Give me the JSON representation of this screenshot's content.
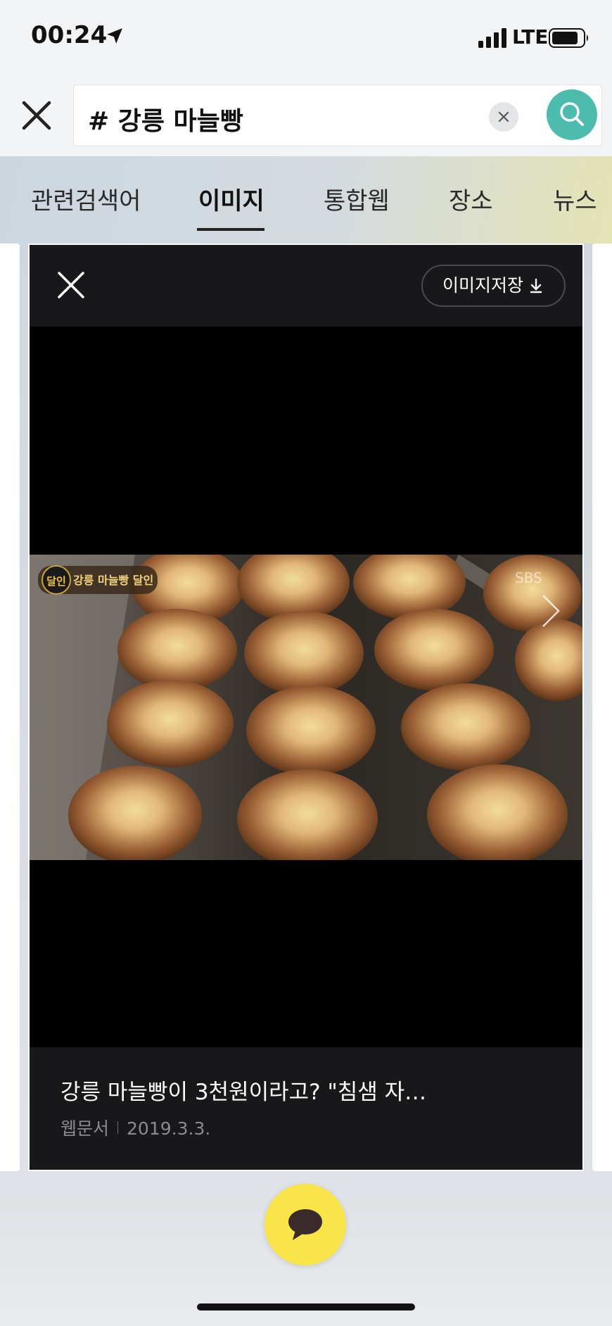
{
  "status_bar": {
    "time": "00:24",
    "network": "LTE",
    "icons": [
      "location-arrow-icon",
      "signal-icon",
      "battery-icon"
    ]
  },
  "search": {
    "query": "# 강릉 마늘빵",
    "icons": [
      "close-icon",
      "clear-icon",
      "search-icon"
    ],
    "accent_color": "#4cbcae"
  },
  "tabs": [
    {
      "label": "관련검색어",
      "active": false
    },
    {
      "label": "이미지",
      "active": true
    },
    {
      "label": "통합웹",
      "active": false
    },
    {
      "label": "장소",
      "active": false
    },
    {
      "label": "뉴스",
      "active": false
    }
  ],
  "viewer": {
    "save_label": "이미지저장",
    "photo_overlay_label": "강릉 마늘빵 달인",
    "photo_badge": "달인",
    "photo_watermark": "SBS",
    "caption_title": "강릉 마늘빵이 3천원이라고? \"침샘 자…",
    "caption_source": "웹문서",
    "caption_date": "2019.3.3."
  },
  "chat_button": {
    "icon": "chat-bubble-icon",
    "color": "#f9e44a"
  }
}
